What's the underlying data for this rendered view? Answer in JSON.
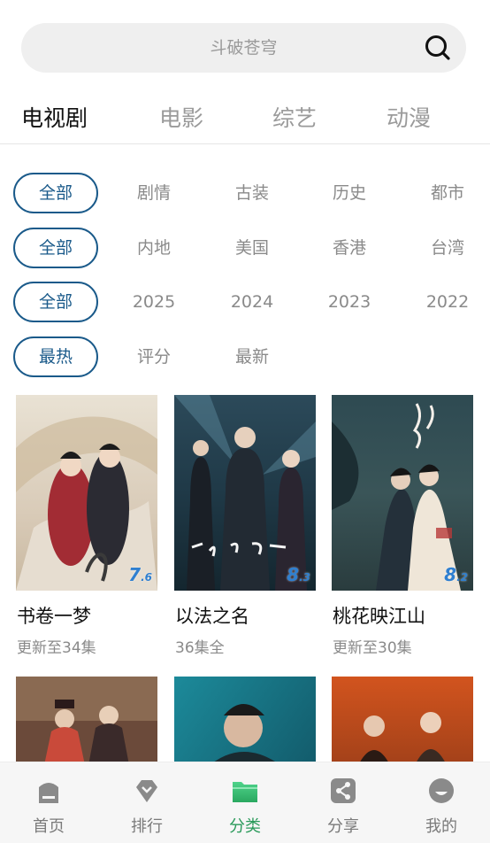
{
  "search": {
    "placeholder": "斗破苍穹",
    "icon": "search-icon"
  },
  "tabs": [
    {
      "label": "电视剧",
      "active": true
    },
    {
      "label": "电影",
      "active": false
    },
    {
      "label": "综艺",
      "active": false
    },
    {
      "label": "动漫",
      "active": false
    }
  ],
  "filters": {
    "genre": {
      "selected": "全部",
      "options": [
        "剧情",
        "古装",
        "历史",
        "都市"
      ]
    },
    "region": {
      "selected": "全部",
      "options": [
        "内地",
        "美国",
        "香港",
        "台湾"
      ]
    },
    "year": {
      "selected": "全部",
      "options": [
        "2025",
        "2024",
        "2023",
        "2022"
      ]
    },
    "sort": {
      "selected": "最热",
      "options": [
        "评分",
        "最新"
      ]
    }
  },
  "cards": [
    {
      "title": "书卷一梦",
      "subtitle": "更新至34集",
      "score_int": "7",
      "score_dec": ".6"
    },
    {
      "title": "以法之名",
      "subtitle": "36集全",
      "score_int": "8",
      "score_dec": ".3"
    },
    {
      "title": "桃花映江山",
      "subtitle": "更新至30集",
      "score_int": "8",
      "score_dec": ".2"
    }
  ],
  "nav": [
    {
      "label": "首页",
      "icon": "home-icon",
      "active": false
    },
    {
      "label": "排行",
      "icon": "ranking-icon",
      "active": false
    },
    {
      "label": "分类",
      "icon": "folder-icon",
      "active": true
    },
    {
      "label": "分享",
      "icon": "share-icon",
      "active": false
    },
    {
      "label": "我的",
      "icon": "profile-icon",
      "active": false
    }
  ],
  "colors": {
    "accent": "#1a5a8a",
    "nav_active": "#2a9a5a",
    "score": "#2f7fd0"
  }
}
